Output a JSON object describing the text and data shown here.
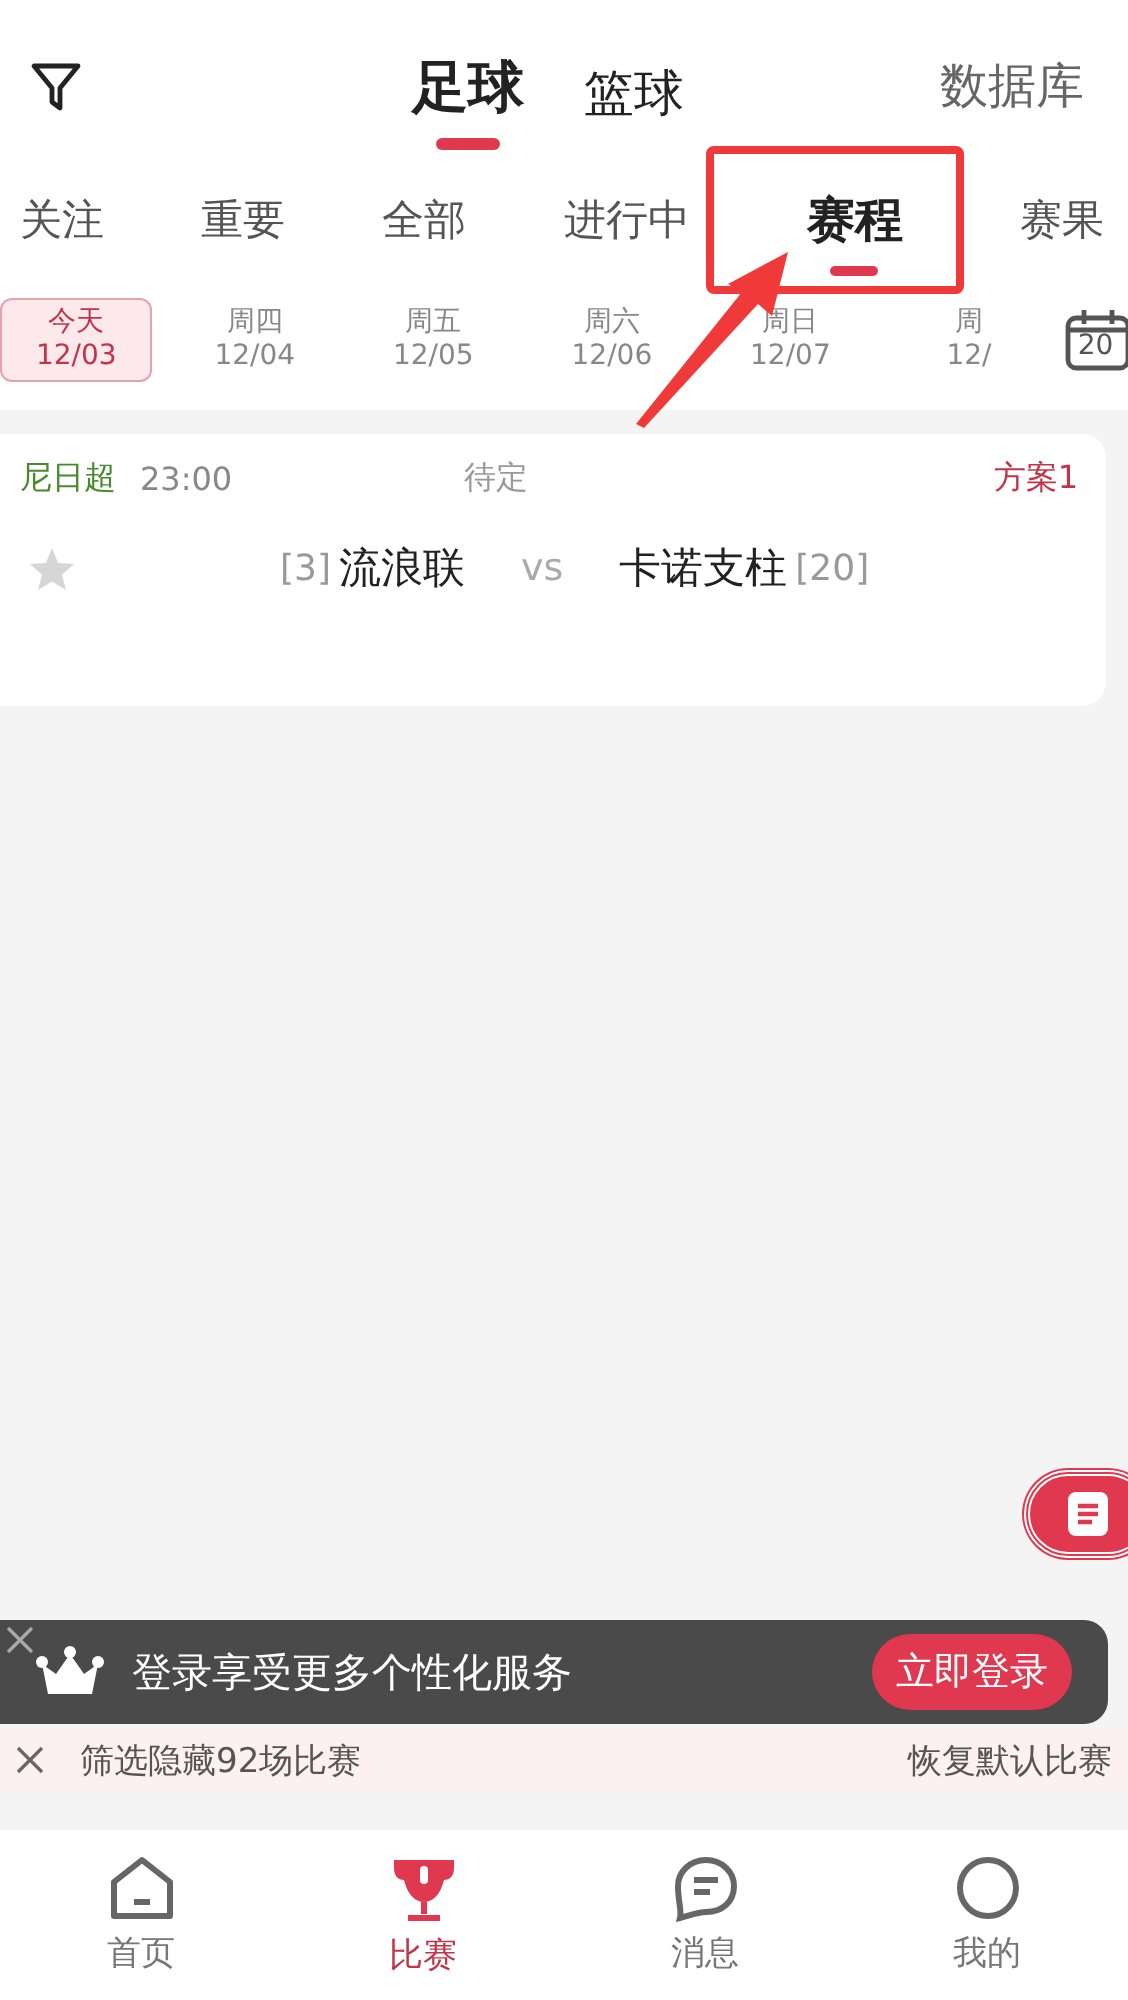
{
  "header": {
    "sport_tabs": [
      {
        "label": "足球",
        "selected": true
      },
      {
        "label": "篮球",
        "selected": false
      }
    ],
    "database_link": "数据库"
  },
  "filter_tabs": [
    {
      "label": "关注",
      "selected": false
    },
    {
      "label": "重要",
      "selected": false
    },
    {
      "label": "全部",
      "selected": false
    },
    {
      "label": "进行中",
      "selected": false
    },
    {
      "label": "赛程",
      "selected": true
    },
    {
      "label": "赛果",
      "selected": false
    }
  ],
  "dates": [
    {
      "weekday": "今天",
      "date": "12/03",
      "selected": true
    },
    {
      "weekday": "周四",
      "date": "12/04",
      "selected": false
    },
    {
      "weekday": "周五",
      "date": "12/05",
      "selected": false
    },
    {
      "weekday": "周六",
      "date": "12/06",
      "selected": false
    },
    {
      "weekday": "周日",
      "date": "12/07",
      "selected": false
    },
    {
      "weekday": "周",
      "date": "12/",
      "selected": false
    }
  ],
  "calendar_button": "20",
  "matches": [
    {
      "league": "尼日超",
      "time": "23:00",
      "status": "待定",
      "plan": "方案1",
      "starred": false,
      "home_rank": "[3]",
      "home": "流浪联",
      "vs": "vs",
      "away": "卡诺支柱",
      "away_rank": "[20]"
    }
  ],
  "login_toast": {
    "message": "登录享受更多个性化服务",
    "button": "立即登录"
  },
  "filter_bar": {
    "hidden_note": "筛选隐藏92场比赛",
    "restore": "恢复默认比赛"
  },
  "bottom_nav": [
    {
      "label": "首页",
      "kind": "home",
      "selected": false
    },
    {
      "label": "比赛",
      "kind": "trophy",
      "selected": true
    },
    {
      "label": "消息",
      "kind": "chat",
      "selected": false
    },
    {
      "label": "我的",
      "kind": "face",
      "selected": false
    }
  ]
}
